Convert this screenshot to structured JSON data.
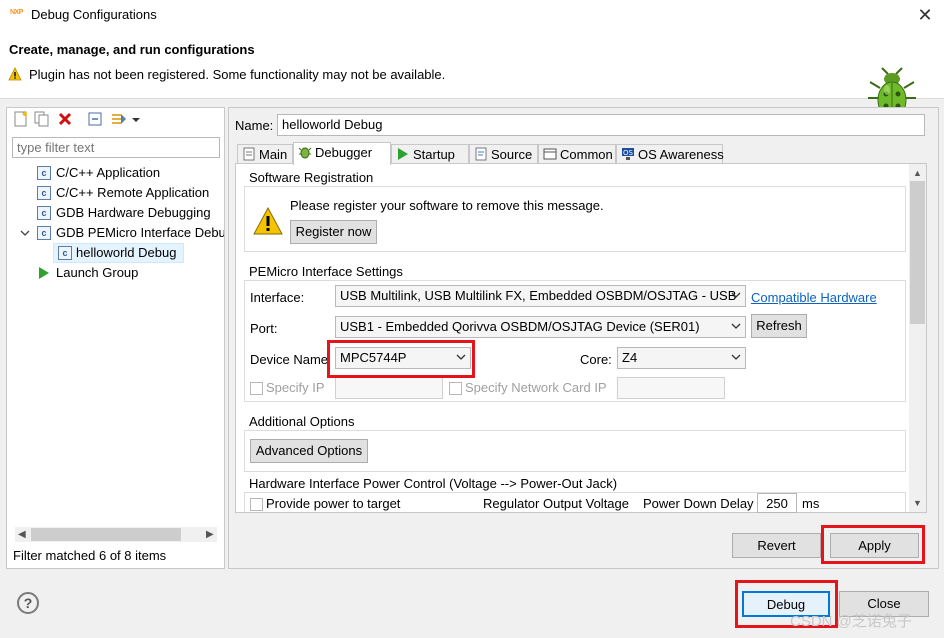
{
  "window": {
    "title": "Debug Configurations",
    "logo_text": "NXP"
  },
  "header": {
    "title": "Create, manage, and run configurations",
    "warning": "Plugin has not been registered. Some functionality may not be available."
  },
  "left": {
    "filter_placeholder": "type filter text",
    "tree": [
      {
        "label": "C/C++ Application"
      },
      {
        "label": "C/C++ Remote Application"
      },
      {
        "label": "GDB Hardware Debugging"
      },
      {
        "label": "GDB PEMicro Interface Debu"
      },
      {
        "label": "helloworld Debug"
      },
      {
        "label": "Launch Group"
      }
    ],
    "status": "Filter matched 6 of 8 items"
  },
  "right": {
    "name_label": "Name:",
    "name_value": "helloworld Debug",
    "tabs": [
      {
        "label": "Main"
      },
      {
        "label": "Debugger"
      },
      {
        "label": "Startup"
      },
      {
        "label": "Source"
      },
      {
        "label": "Common"
      },
      {
        "label": "OS Awareness"
      }
    ],
    "registration": {
      "title": "Software Registration",
      "message": "Please register your software to remove this message.",
      "button": "Register now"
    },
    "pemicro": {
      "title": "PEMicro Interface Settings",
      "interface_label": "Interface:",
      "interface_value": "USB Multilink, USB Multilink FX, Embedded OSBDM/OSJTAG - USB",
      "compatible_link": "Compatible Hardware",
      "port_label": "Port:",
      "port_value": "USB1 - Embedded Qorivva OSBDM/OSJTAG Device (SER01)",
      "refresh": "Refresh",
      "device_label": "Device Name",
      "device_value": "MPC5744P",
      "core_label": "Core:",
      "core_value": "Z4",
      "specify_ip": "Specify IP",
      "specify_nic": "Specify Network Card IP"
    },
    "additional": {
      "title": "Additional Options",
      "button": "Advanced Options"
    },
    "power": {
      "title": "Hardware Interface Power Control (Voltage --> Power-Out Jack)",
      "provide": "Provide power to target",
      "regulator": "Regulator Output Voltage",
      "delay_label": "Power Down Delay",
      "delay_value": "250",
      "delay_unit": "ms"
    },
    "revert": "Revert",
    "apply": "Apply"
  },
  "footer": {
    "debug": "Debug",
    "close": "Close",
    "help": "?",
    "watermark": "CSDN @芝诺兔子"
  }
}
